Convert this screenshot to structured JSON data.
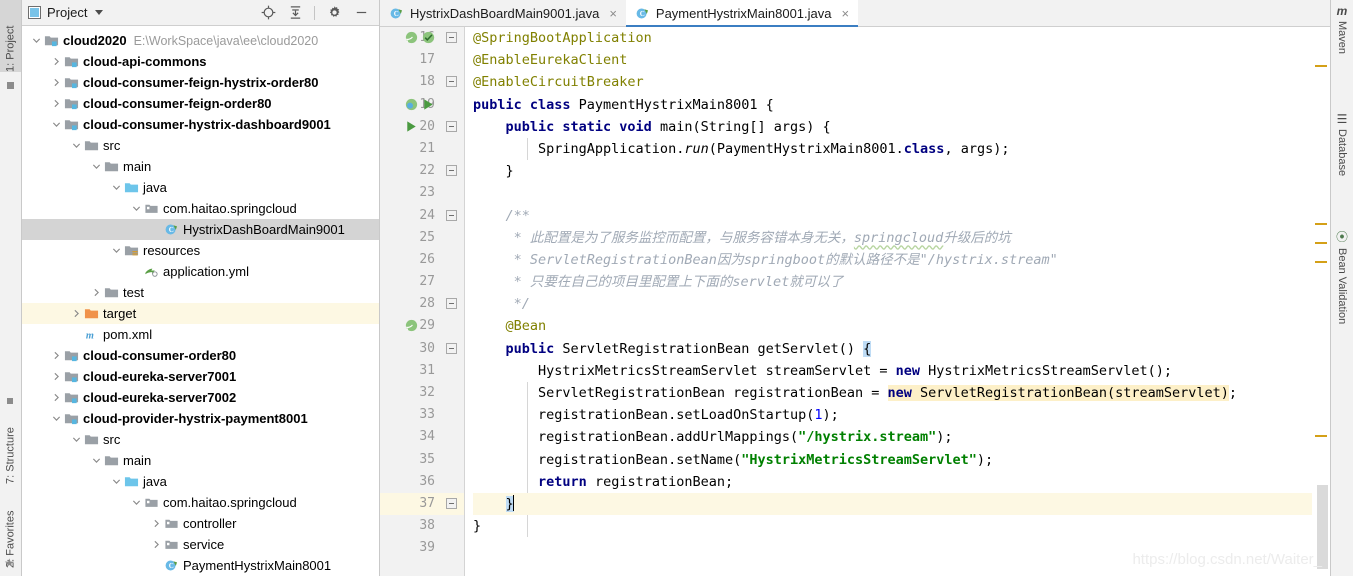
{
  "left_edge": {
    "items": [
      {
        "label": "1: Project",
        "active": true,
        "icon": "project-icon"
      },
      {
        "label": "7: Structure",
        "active": false,
        "icon": "structure-icon"
      },
      {
        "label": "2: Favorites",
        "active": false,
        "icon": "star-icon"
      }
    ]
  },
  "project_panel": {
    "title": "Project",
    "toolbar": [
      {
        "name": "locate-icon",
        "tip": "Select Opened File"
      },
      {
        "name": "collapse-all-icon",
        "tip": "Collapse All"
      },
      {
        "name": "gear-icon",
        "tip": "Settings"
      },
      {
        "name": "minimize-icon",
        "tip": "Hide"
      }
    ],
    "tree": [
      {
        "indent": 0,
        "arrow": "down",
        "icon": "module-folder-icon",
        "label": "cloud2020",
        "bold": true,
        "path": "E:\\WorkSpace\\java\\ee\\cloud2020"
      },
      {
        "indent": 1,
        "arrow": "right",
        "icon": "module-folder-icon",
        "label": "cloud-api-commons",
        "bold": true
      },
      {
        "indent": 1,
        "arrow": "right",
        "icon": "module-folder-icon",
        "label": "cloud-consumer-feign-hystrix-order80",
        "bold": true
      },
      {
        "indent": 1,
        "arrow": "right",
        "icon": "module-folder-icon",
        "label": "cloud-consumer-feign-order80",
        "bold": true
      },
      {
        "indent": 1,
        "arrow": "down",
        "icon": "module-folder-icon",
        "label": "cloud-consumer-hystrix-dashboard9001",
        "bold": true
      },
      {
        "indent": 2,
        "arrow": "down",
        "icon": "folder-icon",
        "label": "src"
      },
      {
        "indent": 3,
        "arrow": "down",
        "icon": "folder-icon",
        "label": "main"
      },
      {
        "indent": 4,
        "arrow": "down",
        "icon": "source-folder-icon",
        "label": "java"
      },
      {
        "indent": 5,
        "arrow": "down",
        "icon": "package-icon",
        "label": "com.haitao.springcloud"
      },
      {
        "indent": 6,
        "arrow": "none",
        "icon": "java-class-run-icon",
        "label": "HystrixDashBoardMain9001",
        "selected": true
      },
      {
        "indent": 4,
        "arrow": "down",
        "icon": "resources-folder-icon",
        "label": "resources"
      },
      {
        "indent": 5,
        "arrow": "none",
        "icon": "yaml-icon",
        "label": "application.yml"
      },
      {
        "indent": 3,
        "arrow": "right",
        "icon": "folder-icon",
        "label": "test"
      },
      {
        "indent": 2,
        "arrow": "right",
        "icon": "target-folder-icon",
        "label": "target",
        "highlight": true
      },
      {
        "indent": 2,
        "arrow": "none",
        "icon": "maven-pom-icon",
        "label": "pom.xml"
      },
      {
        "indent": 1,
        "arrow": "right",
        "icon": "module-folder-icon",
        "label": "cloud-consumer-order80",
        "bold": true
      },
      {
        "indent": 1,
        "arrow": "right",
        "icon": "module-folder-icon",
        "label": "cloud-eureka-server7001",
        "bold": true
      },
      {
        "indent": 1,
        "arrow": "right",
        "icon": "module-folder-icon",
        "label": "cloud-eureka-server7002",
        "bold": true
      },
      {
        "indent": 1,
        "arrow": "down",
        "icon": "module-folder-icon",
        "label": "cloud-provider-hystrix-payment8001",
        "bold": true
      },
      {
        "indent": 2,
        "arrow": "down",
        "icon": "folder-icon",
        "label": "src"
      },
      {
        "indent": 3,
        "arrow": "down",
        "icon": "folder-icon",
        "label": "main"
      },
      {
        "indent": 4,
        "arrow": "down",
        "icon": "source-folder-icon",
        "label": "java"
      },
      {
        "indent": 5,
        "arrow": "down",
        "icon": "package-icon",
        "label": "com.haitao.springcloud"
      },
      {
        "indent": 6,
        "arrow": "right",
        "icon": "package-icon",
        "label": "controller"
      },
      {
        "indent": 6,
        "arrow": "right",
        "icon": "package-icon",
        "label": "service"
      },
      {
        "indent": 6,
        "arrow": "none",
        "icon": "java-class-run-icon",
        "label": "PaymentHystrixMain8001"
      }
    ]
  },
  "editor": {
    "tabs": [
      {
        "label": "HystrixDashBoardMain9001.java",
        "icon": "java-class-run-icon",
        "active": false,
        "close": "×"
      },
      {
        "label": "PaymentHystrixMain8001.java",
        "icon": "java-class-run-icon",
        "active": true,
        "close": "×"
      }
    ],
    "first_line": 16,
    "lines": [
      {
        "n": 16,
        "gutter": [
          "bean-icon",
          "spring-boot-icon"
        ],
        "fold": "minus"
      },
      {
        "n": 17,
        "gutter": [],
        "fold": ""
      },
      {
        "n": 18,
        "gutter": [],
        "fold": "minus"
      },
      {
        "n": 19,
        "gutter": [
          "spring-bean-icon",
          "run-icon"
        ],
        "fold": ""
      },
      {
        "n": 20,
        "gutter": [
          "run-icon"
        ],
        "fold": "minus"
      },
      {
        "n": 21,
        "gutter": [],
        "fold": ""
      },
      {
        "n": 22,
        "gutter": [],
        "fold": "minus"
      },
      {
        "n": 23,
        "gutter": [],
        "fold": ""
      },
      {
        "n": 24,
        "gutter": [],
        "fold": "minus"
      },
      {
        "n": 25,
        "gutter": [],
        "fold": ""
      },
      {
        "n": 26,
        "gutter": [],
        "fold": ""
      },
      {
        "n": 27,
        "gutter": [],
        "fold": ""
      },
      {
        "n": 28,
        "gutter": [],
        "fold": "minus"
      },
      {
        "n": 29,
        "gutter": [
          "bean-icon"
        ],
        "fold": ""
      },
      {
        "n": 30,
        "gutter": [],
        "fold": "minus"
      },
      {
        "n": 31,
        "gutter": [],
        "fold": ""
      },
      {
        "n": 32,
        "gutter": [],
        "fold": ""
      },
      {
        "n": 33,
        "gutter": [],
        "fold": ""
      },
      {
        "n": 34,
        "gutter": [],
        "fold": ""
      },
      {
        "n": 35,
        "gutter": [],
        "fold": ""
      },
      {
        "n": 36,
        "gutter": [],
        "fold": ""
      },
      {
        "n": 37,
        "gutter": [],
        "fold": "minus",
        "highlight": true
      },
      {
        "n": 38,
        "gutter": [],
        "fold": ""
      },
      {
        "n": 39,
        "gutter": [],
        "fold": ""
      }
    ],
    "code_text": [
      "@SpringBootApplication",
      "@EnableEurekaClient",
      "@EnableCircuitBreaker",
      "public class PaymentHystrixMain8001 {",
      "    public static void main(String[] args) {",
      "        SpringApplication.run(PaymentHystrixMain8001.class, args);",
      "    }",
      "",
      "    /**",
      "     * 此配置是为了服务监控而配置，与服务容错本身无关，springcloud升级后的坑",
      "     * ServletRegistrationBean因为springboot的默认路径不是\"/hystrix.stream\"",
      "     * 只要在自己的项目里配置上下面的servlet就可以了",
      "     */",
      "    @Bean",
      "    public ServletRegistrationBean getServlet() {",
      "        HystrixMetricsStreamServlet streamServlet = new HystrixMetricsStreamServlet();",
      "        ServletRegistrationBean registrationBean = new ServletRegistrationBean(streamServlet);",
      "        registrationBean.setLoadOnStartup(1);",
      "        registrationBean.addUrlMappings(\"/hystrix.stream\");",
      "        registrationBean.setName(\"HystrixMetricsStreamServlet\");",
      "        return registrationBean;",
      "    }",
      "}",
      ""
    ],
    "colors": {
      "keyword": "#000080",
      "annotation": "#808000",
      "string": "#008000",
      "number": "#0000ff",
      "comment": "#a0a9b5",
      "search_highlight": "#fdf0c8",
      "caret_line": "#fdf8e3",
      "brace_match": "#bfdcf5",
      "active_tab_underline": "#3b7ec2"
    }
  },
  "right_edge": {
    "items": [
      {
        "label": "Maven",
        "icon": "maven-icon"
      },
      {
        "label": "Database",
        "icon": "database-icon"
      },
      {
        "label": "Bean Validation",
        "icon": "bean-validation-icon"
      }
    ]
  },
  "watermark": "https://blog.csdn.net/Waiter_"
}
